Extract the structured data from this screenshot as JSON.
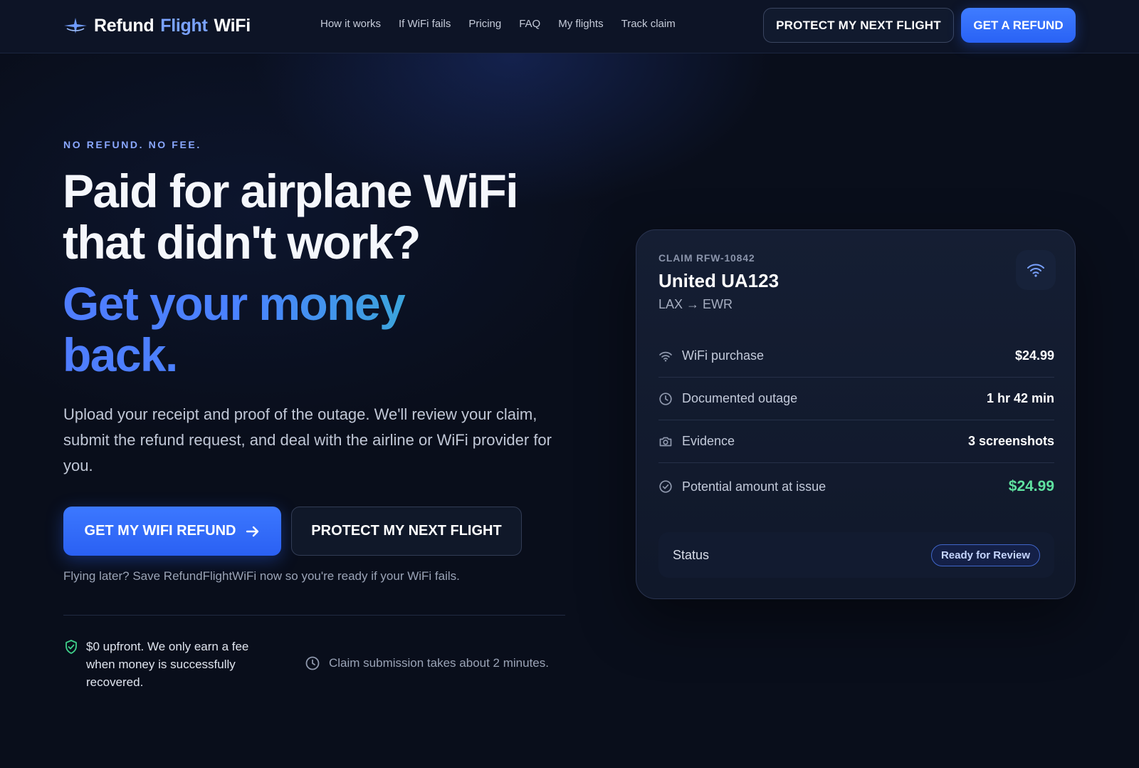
{
  "nav": {
    "logo_words": [
      "Refund",
      "Flight",
      "WiFi"
    ],
    "links": [
      "How it works",
      "If WiFi fails",
      "Pricing",
      "FAQ",
      "My flights",
      "Track claim"
    ],
    "protect_label": "PROTECT MY NEXT FLIGHT",
    "refund_label": "GET A REFUND"
  },
  "hero": {
    "eyebrow": "NO REFUND. NO FEE.",
    "headline": "Paid for airplane WiFi that didn't work?",
    "headline_accent": "Get your money back.",
    "lead": "Upload your receipt and proof of the outage. We'll review your claim, submit the refund request, and deal with the airline or WiFi provider for you.",
    "cta_primary": "GET MY WIFI REFUND",
    "cta_secondary": "PROTECT MY NEXT FLIGHT",
    "sub_note": "Flying later? Save RefundFlightWiFi now so you're ready if your WiFi fails.",
    "trust_fee": "$0 upfront. We only earn a fee when money is successfully recovered.",
    "trust_time": "Claim submission takes about 2 minutes."
  },
  "claim_card": {
    "claim_id": "CLAIM RFW-10842",
    "flight": "United UA123",
    "route": "LAX → EWR",
    "rows": [
      {
        "icon": "wifi-icon",
        "label": "WiFi purchase",
        "value": "$24.99"
      },
      {
        "icon": "clock-icon",
        "label": "Documented outage",
        "value": "1 hr 42 min"
      },
      {
        "icon": "camera-icon",
        "label": "Evidence",
        "value": "3 screenshots"
      },
      {
        "icon": "check-circle-icon",
        "label": "Potential amount at issue",
        "value": "$24.99"
      }
    ],
    "status_label": "Status",
    "status_value": "Ready for Review"
  },
  "colors": {
    "accent": "#2f68ff",
    "success": "#5fe2a0",
    "background": "#090e1b"
  }
}
